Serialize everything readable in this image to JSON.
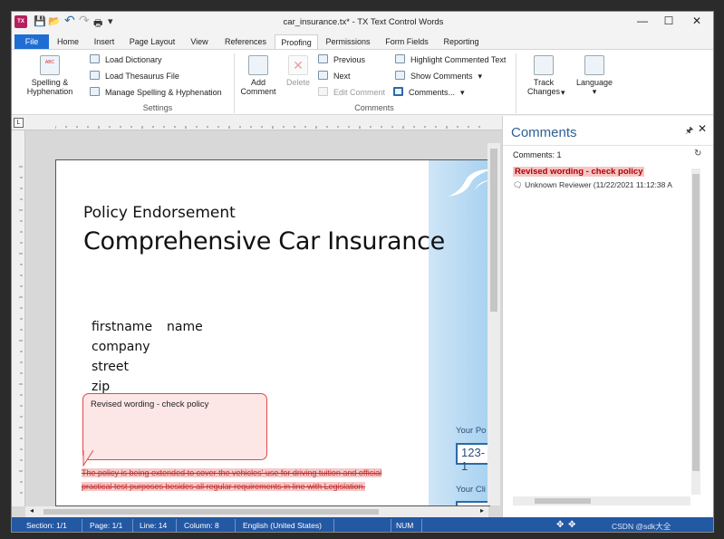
{
  "window": {
    "title": "car_insurance.tx* - TX Text Control Words",
    "app_icon_label": "TX",
    "controls": {
      "minimize": "—",
      "maximize": "☐",
      "close": "✕"
    }
  },
  "quick_access": {
    "save": "💾",
    "open": "📂",
    "undo": "↶",
    "redo": "↷",
    "print": "🖶",
    "more": "▾"
  },
  "tabs": [
    {
      "label": "File"
    },
    {
      "label": "Home"
    },
    {
      "label": "Insert"
    },
    {
      "label": "Page Layout"
    },
    {
      "label": "View"
    },
    {
      "label": "References"
    },
    {
      "label": "Proofing"
    },
    {
      "label": "Permissions"
    },
    {
      "label": "Form Fields"
    },
    {
      "label": "Reporting"
    }
  ],
  "ribbon": {
    "spelling": {
      "label1": "Spelling &",
      "label2": "Hyphenation",
      "icon": "spelling-icon",
      "icon_text": "ABC"
    },
    "settings": {
      "items": [
        {
          "label": "Load Dictionary"
        },
        {
          "label": "Load Thesaurus File"
        },
        {
          "label": "Manage Spelling & Hyphenation"
        }
      ],
      "group_label": "Settings"
    },
    "comments": {
      "add1": "Add",
      "add2": "Comment",
      "delete": "Delete",
      "previous": "Previous",
      "next": "Next",
      "edit": "Edit Comment",
      "highlight": "Highlight Commented Text",
      "show": "Show Comments",
      "comments": "Comments...",
      "group_label": "Comments"
    },
    "track": {
      "label1": "Track",
      "label2": "Changes"
    },
    "language": {
      "label": "Language"
    }
  },
  "document": {
    "subtitle": "Policy Endorsement",
    "title": "Comprehensive Car Insurance",
    "fields": {
      "firstname": "firstname",
      "name": "name",
      "company": "company",
      "street": "street",
      "zip": "zip"
    },
    "comment_bubble": "Revised wording - check policy",
    "deleted_line1": "The policy is being extended to cover the vehicles' use for driving tuition and official",
    "deleted_line2": "practical test purposes besides all regular requirements in line with Legislation.",
    "form_label1": "Your Po",
    "form_value1": "123-1",
    "form_label2": "Your Cli"
  },
  "comments_pane": {
    "title": "Comments",
    "count": "Comments: 1",
    "item": {
      "text": "Revised wording - check policy",
      "author": "Unknown Reviewer",
      "time": "(11/22/2021 11:12:38 A"
    }
  },
  "status_bar": {
    "section": "Section: 1/1",
    "page": "Page: 1/1",
    "line": "Line: 14",
    "column": "Column: 8",
    "language": "English (United States)",
    "num": "NUM",
    "watermark": "CSDN @sdk大全"
  },
  "colors": {
    "accent": "#1f6ed4",
    "status": "#2358a3",
    "comment_red": "#e04b4b"
  }
}
